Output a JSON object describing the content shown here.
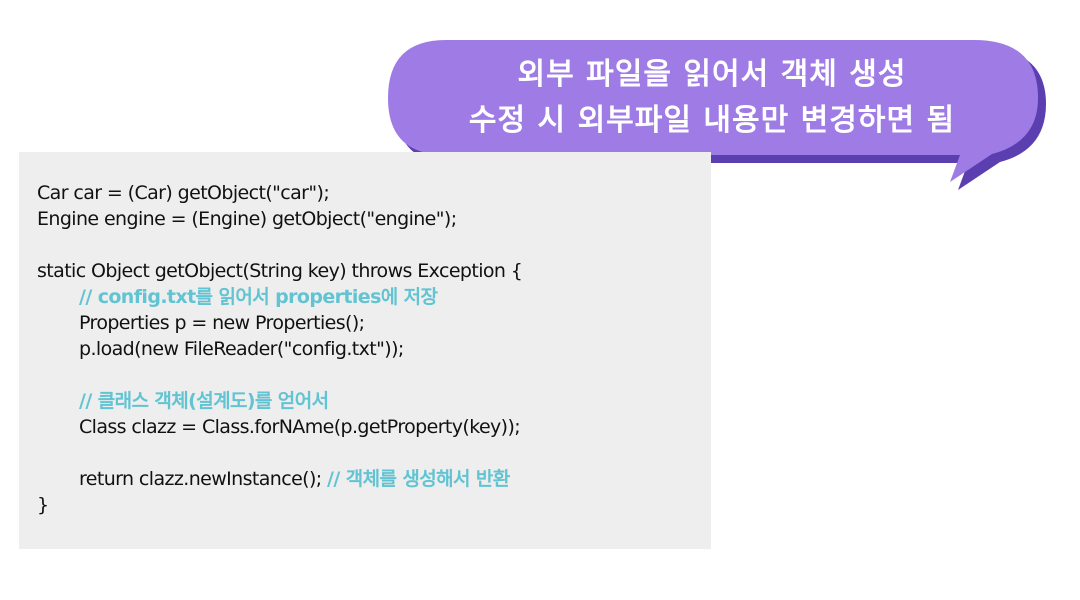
{
  "speech_bubble": {
    "line1": "외부 파일을 읽어서 객체 생성",
    "line2": "수정 시 외부파일 내용만 변경하면 됨",
    "fill_color": "#9f7be6",
    "shadow_color": "#5b3fb0"
  },
  "code": {
    "lines": {
      "l1": "Car car = (Car) getObject(\"car\");",
      "l2": "Engine engine = (Engine) getObject(\"engine\");",
      "l3": "static Object getObject(String key) throws Exception {",
      "l4_comment": "// config.txt를 읽어서 properties에 저장",
      "l5": "Properties p = new Properties();",
      "l6": "p.load(new FileReader(\"config.txt\"));",
      "l7_comment": "// 클래스 객체(설계도)를 얻어서",
      "l8": "Class clazz = Class.forNAme(p.getProperty(key));",
      "l9_code": "return clazz.newInstance(); ",
      "l9_comment": "// 객체를 생성해서 반환",
      "l10": "}"
    },
    "comment_color": "#62c4d2",
    "background_color": "#eeeeee"
  }
}
